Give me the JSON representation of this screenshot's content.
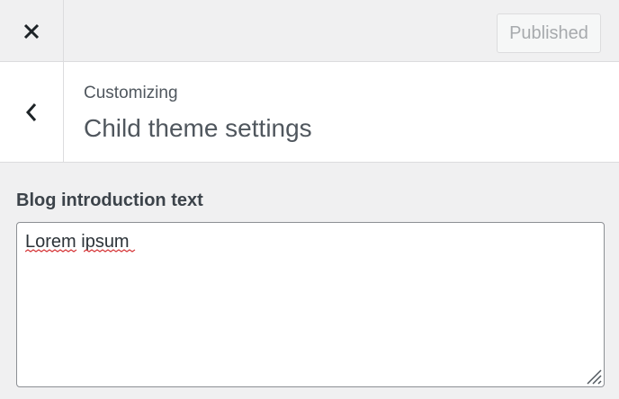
{
  "header": {
    "close_icon": "close-icon",
    "publish_label": "Published"
  },
  "section": {
    "back_icon": "chevron-left-icon",
    "breadcrumb": "Customizing",
    "title": "Child theme settings"
  },
  "control": {
    "label": "Blog introduction text",
    "value": "Lorem ipsum",
    "misspelled_words": [
      "Lorem",
      "ipsum"
    ]
  },
  "colors": {
    "background": "#f0f0f1",
    "panel": "#ffffff",
    "border": "#dcdcde",
    "text": "#50575e",
    "disabled_text": "#a7aaad",
    "spellcheck": "#d63638"
  }
}
